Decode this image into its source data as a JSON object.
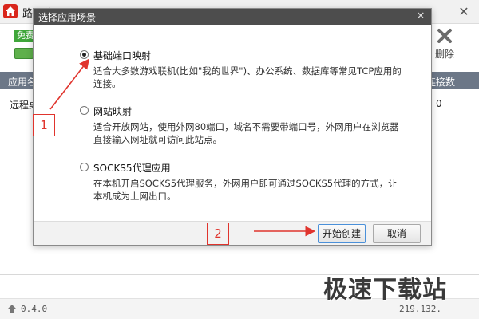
{
  "app": {
    "title": "路由侠",
    "close_glyph": "✕",
    "free_badge": "免费",
    "delete_label": "删除"
  },
  "list": {
    "header_left": "应用名",
    "header_right": "连接数",
    "row_left": "远程桌",
    "row_right": "0"
  },
  "status": {
    "version": "0.4.0",
    "ip": "219.132."
  },
  "watermark": "极速下载站",
  "dialog": {
    "title": "选择应用场景",
    "close_glyph": "✕",
    "options": [
      {
        "label": "基础端口映射",
        "description": "适合大多数游戏联机(比如\"我的世界\")、办公系统、数据库等常见TCP应用的连接。",
        "checked": true
      },
      {
        "label": "网站映射",
        "description": "适合开放网站，使用外网80端口，域名不需要带端口号，外网用户在浏览器直接输入网址就可访问此站点。",
        "checked": false
      },
      {
        "label": "SOCKS5代理应用",
        "description": "在本机开启SOCKS5代理服务，外网用户即可通过SOCKS5代理的方式，让本机成为上网出口。",
        "checked": false
      }
    ],
    "create_button": "开始创建",
    "cancel_button": "取消"
  },
  "annotations": {
    "box1": "1",
    "box2": "2",
    "color": "#e0342d"
  },
  "colors": {
    "header_bar": "#6c7787",
    "dialog_titlebar": "#4d4d4d",
    "brand_red": "#d9261c",
    "free_green": "#3fa63a"
  }
}
